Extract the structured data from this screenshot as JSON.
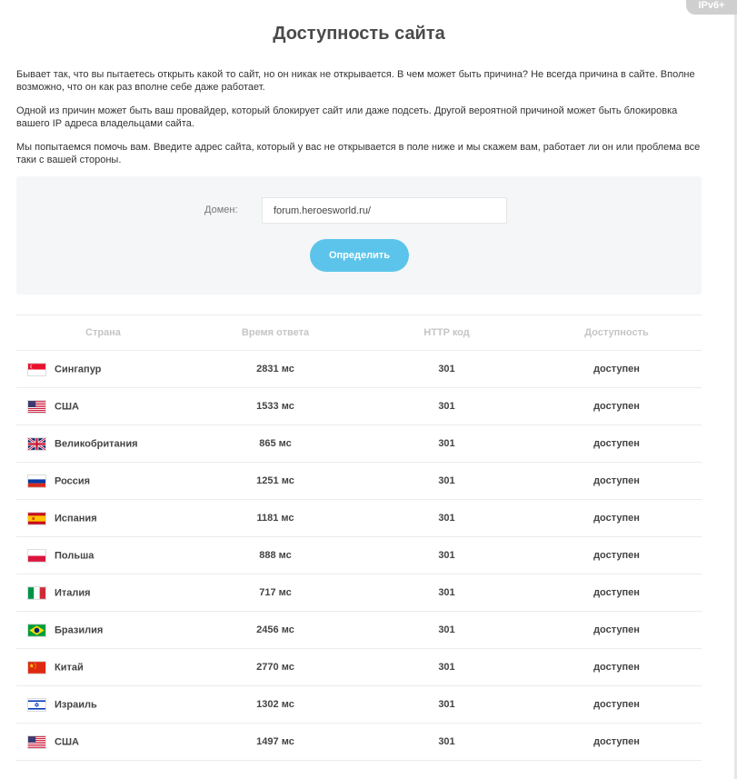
{
  "badge": "IPv6+",
  "title": "Доступность сайта",
  "paragraphs": [
    "Бывает так, что вы пытаетесь открыть какой то сайт, но он никак не открывается. В чем может быть причина? Не всегда причина в сайте. Вполне возможно, что он как раз вполне себе даже работает.",
    "Одной из причин может быть ваш провайдер, который блокирует сайт или даже подсеть. Другой вероятной причиной может быть блокировка вашего IP адреса владельцами сайта.",
    "Мы попытаемся помочь вам. Введите адрес сайта, который у вас не открывается в поле ниже и мы скажем вам, работает ли он или проблема все таки с вашей стороны."
  ],
  "form": {
    "domain_label": "Домен:",
    "domain_value": "forum.heroesworld.ru/",
    "button_label": "Определить"
  },
  "table": {
    "headers": [
      "Страна",
      "Время ответа",
      "HTTP код",
      "Доступность"
    ],
    "rows": [
      {
        "flag": "sg",
        "country": "Сингапур",
        "time": "2831 мс",
        "code": "301",
        "status": "доступен"
      },
      {
        "flag": "us",
        "country": "США",
        "time": "1533 мс",
        "code": "301",
        "status": "доступен"
      },
      {
        "flag": "gb",
        "country": "Великобритания",
        "time": "865 мс",
        "code": "301",
        "status": "доступен"
      },
      {
        "flag": "ru",
        "country": "Россия",
        "time": "1251 мс",
        "code": "301",
        "status": "доступен"
      },
      {
        "flag": "es",
        "country": "Испания",
        "time": "1181 мс",
        "code": "301",
        "status": "доступен"
      },
      {
        "flag": "pl",
        "country": "Польша",
        "time": "888 мс",
        "code": "301",
        "status": "доступен"
      },
      {
        "flag": "it",
        "country": "Италия",
        "time": "717 мс",
        "code": "301",
        "status": "доступен"
      },
      {
        "flag": "br",
        "country": "Бразилия",
        "time": "2456 мс",
        "code": "301",
        "status": "доступен"
      },
      {
        "flag": "cn",
        "country": "Китай",
        "time": "2770 мс",
        "code": "301",
        "status": "доступен"
      },
      {
        "flag": "il",
        "country": "Израиль",
        "time": "1302 мс",
        "code": "301",
        "status": "доступен"
      },
      {
        "flag": "us",
        "country": "США",
        "time": "1497 мс",
        "code": "301",
        "status": "доступен"
      }
    ]
  },
  "colors": {
    "button": "#5cc4ea",
    "available": "#2a9a2a",
    "form_bg": "#f4f6f7"
  }
}
